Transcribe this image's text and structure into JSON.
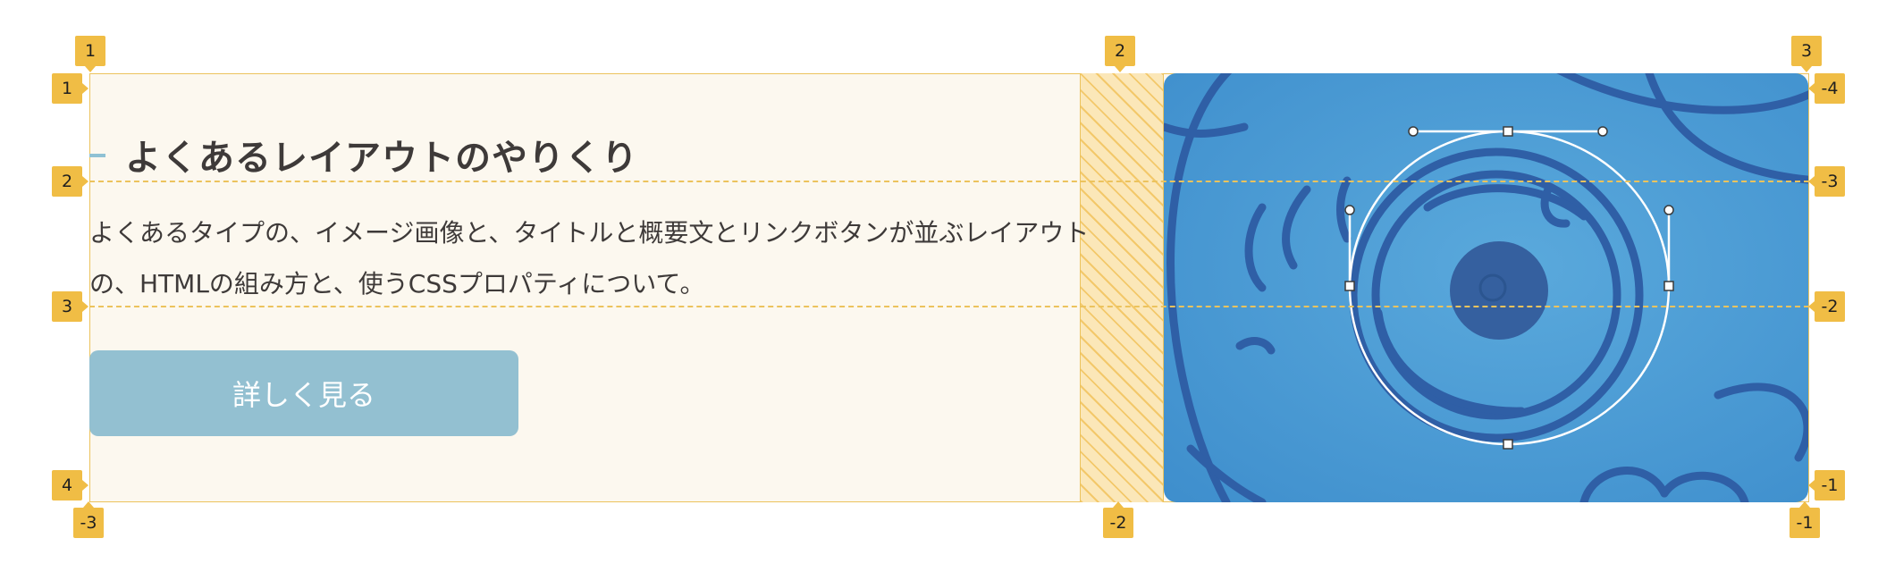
{
  "content": {
    "title": "よくあるレイアウトのやりくり",
    "description_line1": "よくあるタイプの、イメージ画像と、タイトルと概要文とリンクボタンが並ぶレイアウト",
    "description_line2": "の、HTMLの組み方と、使うCSSプロパティについて。",
    "button_label": "詳しく見る"
  },
  "grid_overlay": {
    "column_labels_top": [
      "1",
      "2",
      "3"
    ],
    "column_labels_bottom": [
      "-3",
      "-2",
      "-1"
    ],
    "row_labels_left": [
      "1",
      "2",
      "3",
      "4"
    ],
    "row_labels_right": [
      "-4",
      "-3",
      "-2",
      "-1"
    ]
  },
  "colors": {
    "grid_line": "#ecc35d",
    "badge": "#f0bd45",
    "button": "#93c0d1",
    "background": "#fcf8ef",
    "image_blue": "#4f9ed6",
    "image_line": "#2f5fa6"
  }
}
